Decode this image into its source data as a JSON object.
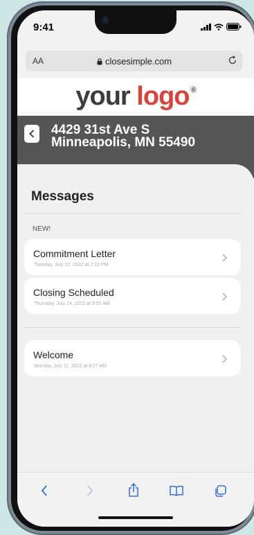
{
  "status": {
    "time": "9:41"
  },
  "browser": {
    "text_size": "AA",
    "url": "closesimple.com"
  },
  "logo": {
    "part1": "your",
    "part2": "logo",
    "mark": "®"
  },
  "address": {
    "line1": "4429 31st Ave S",
    "line2": "Minneapolis, MN 55490"
  },
  "messages": {
    "title": "Messages",
    "new_label": "NEW!",
    "items": [
      {
        "title": "Commitment Letter",
        "date": "Tuesday, July 12, 2022 at 2:15 PM"
      },
      {
        "title": "Closing Scheduled",
        "date": "Thursday, July 14, 2022 at 9:57 AM"
      },
      {
        "title": "Welcome",
        "date": "Monday, July 11, 2022 at 8:27 AM"
      }
    ]
  },
  "colors": {
    "accent": "#d9443a",
    "header_bg": "#555555",
    "logo_gray": "#3d3d3d",
    "toolbar_blue": "#2f6fd6"
  }
}
